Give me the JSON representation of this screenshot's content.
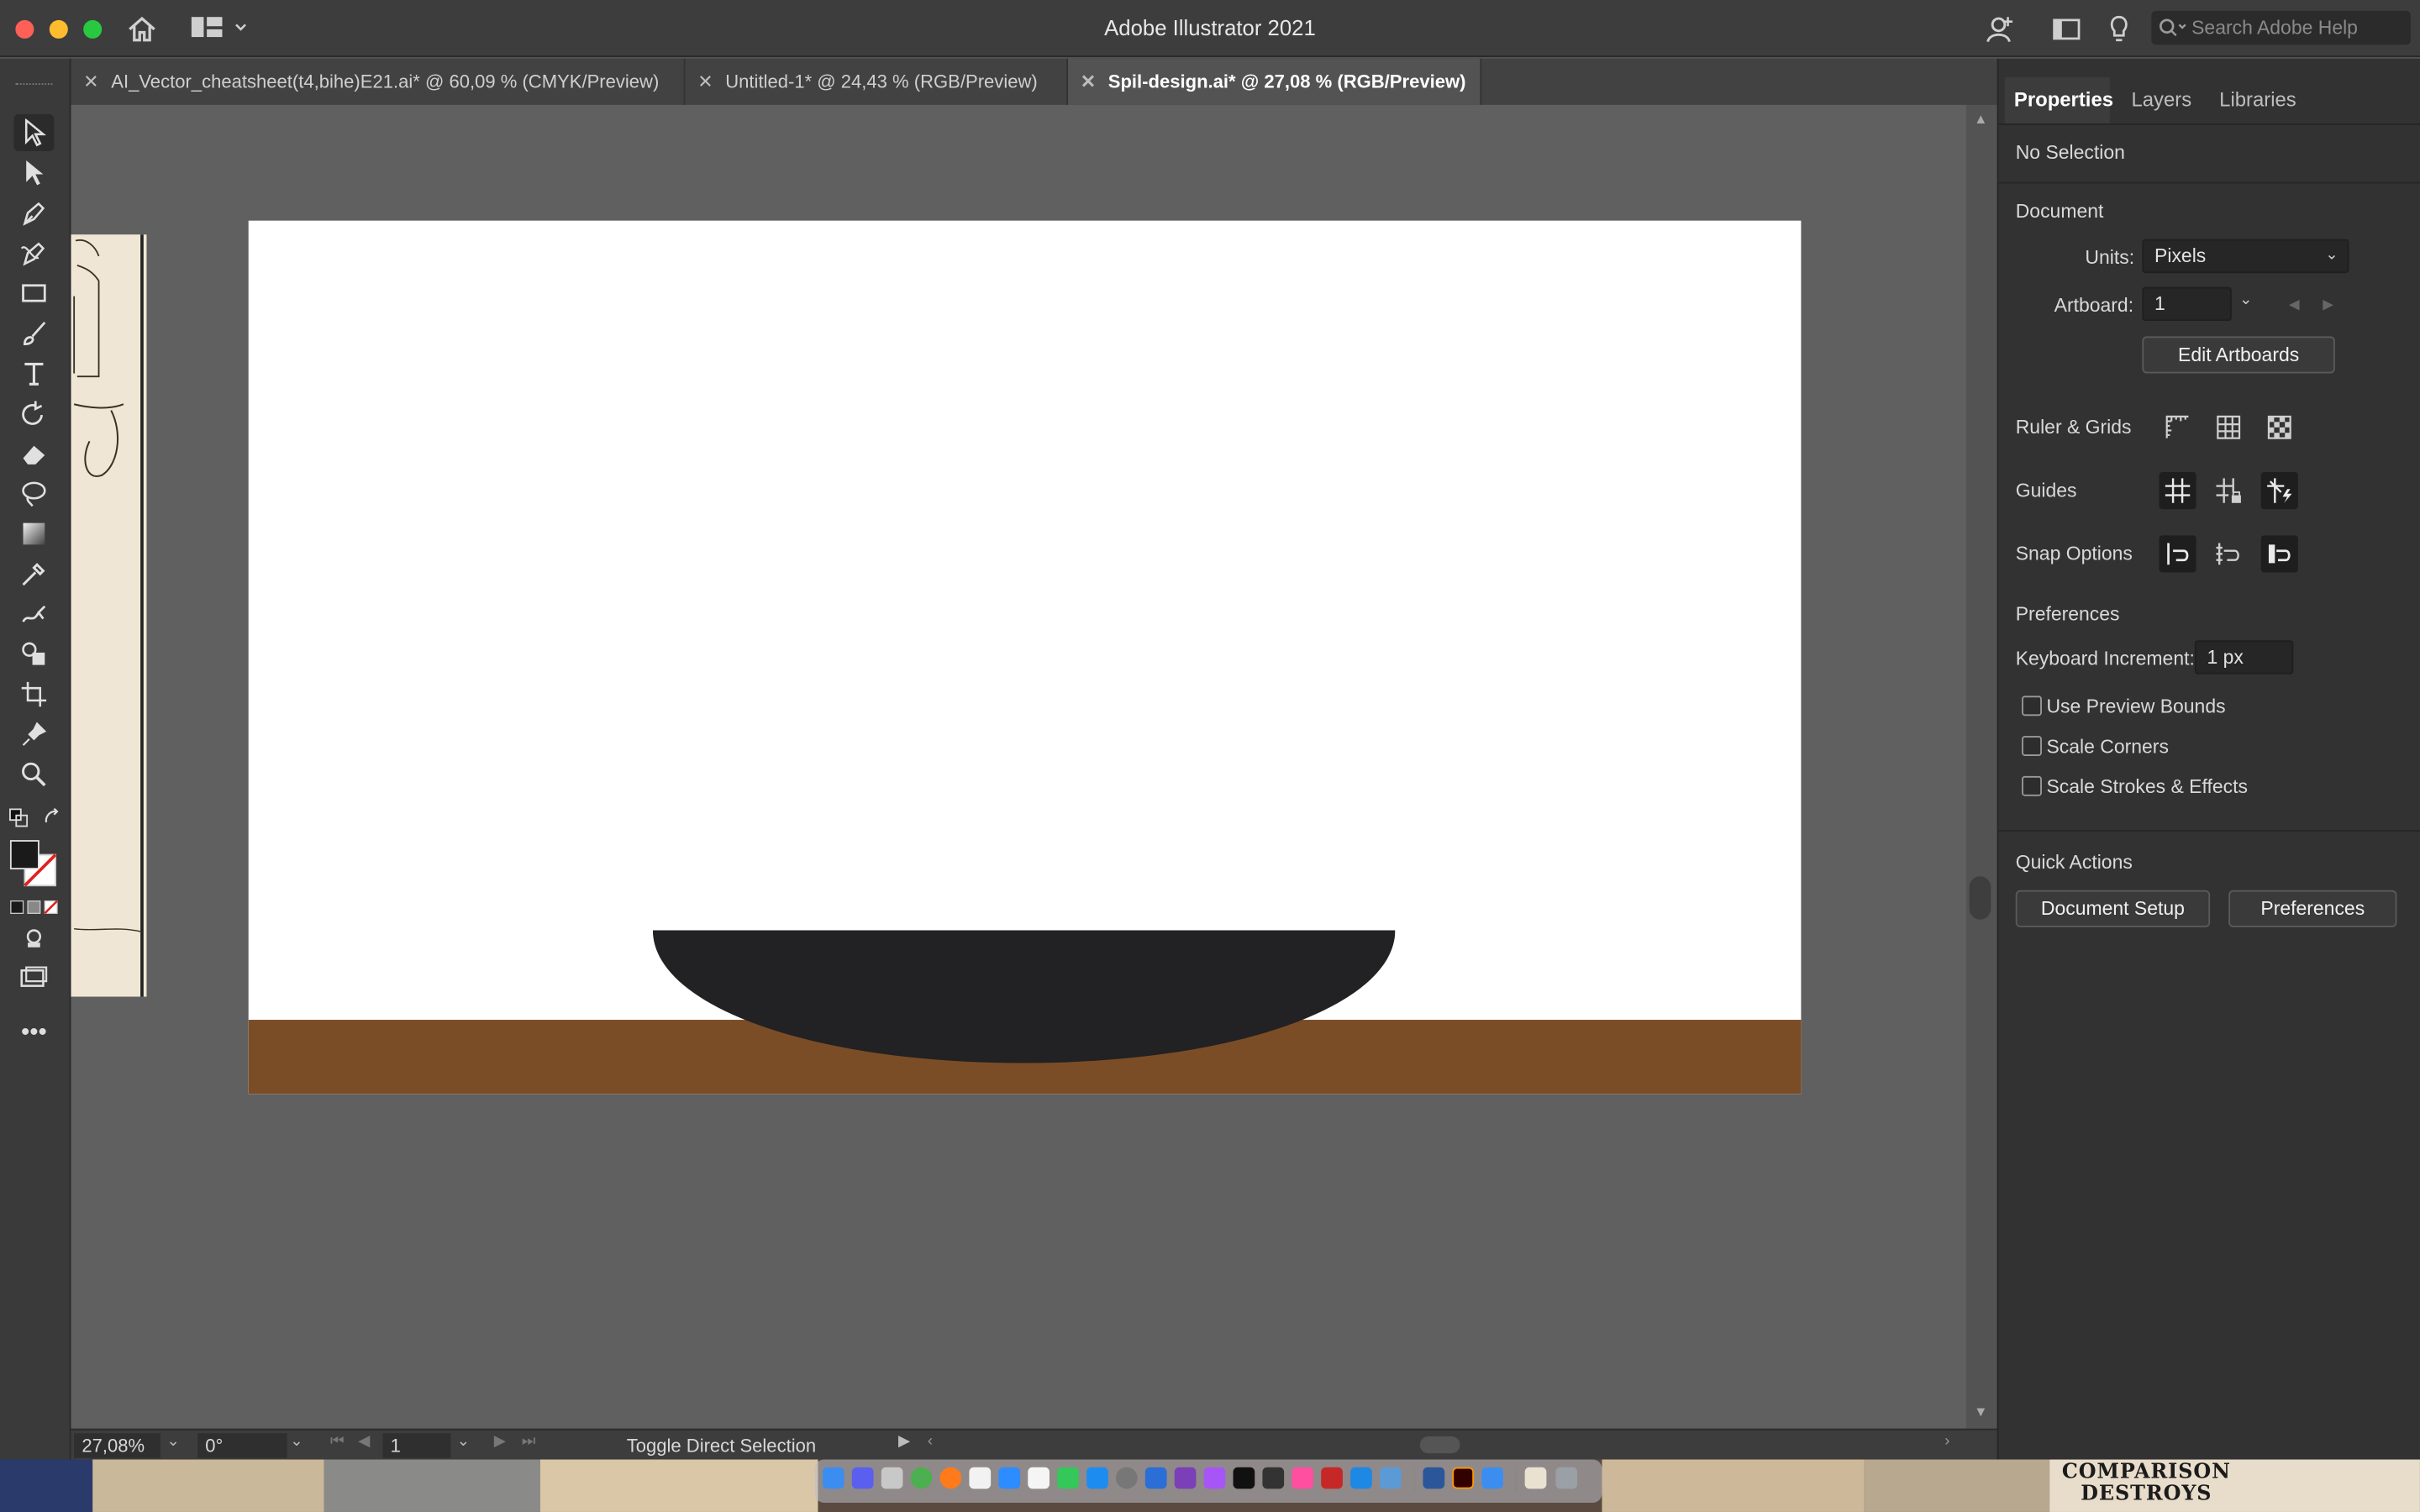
{
  "app": {
    "title": "Adobe Illustrator 2021",
    "search_placeholder": "Search Adobe Help"
  },
  "tabs": [
    {
      "label": "AI_Vector_cheatsheet(t4,bihe)E21.ai* @ 60,09 % (CMYK/Preview)",
      "active": false
    },
    {
      "label": "Untitled-1* @ 24,43 % (RGB/Preview)",
      "active": false
    },
    {
      "label": "Spil-design.ai* @ 27,08 % (RGB/Preview)",
      "active": true
    }
  ],
  "tools": [
    "selection-tool",
    "direct-selection-tool",
    "pen-tool",
    "curvature-tool",
    "rectangle-tool",
    "paintbrush-tool",
    "type-tool",
    "rotate-tool",
    "eraser-tool",
    "lasso-tool",
    "gradient-tool",
    "eyedropper-tool",
    "puppet-warp-tool",
    "shape-builder-tool",
    "artboard-tool",
    "pin-tool",
    "zoom-tool"
  ],
  "canvas": {
    "artboard_bg": "#ffffff",
    "ground_color": "#7b4d26",
    "bowl_color": "#222123"
  },
  "status": {
    "zoom": "27,08%",
    "rotation": "0°",
    "artboard": "1",
    "tool_hint": "Toggle Direct Selection"
  },
  "panel": {
    "tabs": [
      "Properties",
      "Layers",
      "Libraries"
    ],
    "selection": "No Selection",
    "document_header": "Document",
    "units_label": "Units:",
    "units_value": "Pixels",
    "artboard_label": "Artboard:",
    "artboard_value": "1",
    "edit_artboards": "Edit Artboards",
    "ruler_grids": "Ruler & Grids",
    "guides": "Guides",
    "snap_options": "Snap Options",
    "preferences_header": "Preferences",
    "keyboard_increment_label": "Keyboard Increment:",
    "keyboard_increment_value": "1 px",
    "checkboxes": [
      "Use Preview Bounds",
      "Scale Corners",
      "Scale Strokes & Effects"
    ],
    "quick_actions": "Quick Actions",
    "document_setup": "Document Setup",
    "preferences_button": "Preferences"
  },
  "dock_overlay_text": {
    "line1": "COMPARISON",
    "line2": "DESTROYS"
  }
}
